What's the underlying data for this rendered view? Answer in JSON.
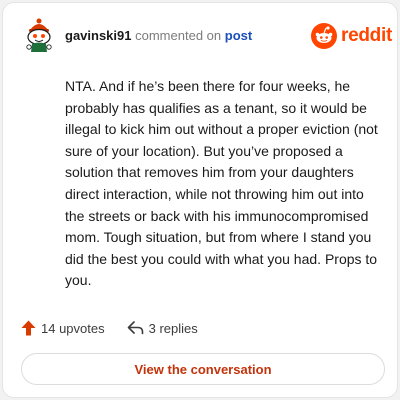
{
  "comment": {
    "username": "gavinski91",
    "action_text": "commented on",
    "post_link": "post",
    "body": "NTA. And if he’s been there for four weeks, he probably has qualifies as a tenant, so it would be illegal to kick him out without a proper eviction (not sure of your location). But you’ve proposed a solution that removes him from your daughters direct interaction, while not throwing him out into the streets or back with his immunocompromised mom. Tough situation, but from where I stand you did the best you could with what you had. Props to you."
  },
  "brand": {
    "wordmark": "reddit",
    "color": "#ff4500"
  },
  "actions": {
    "upvotes_label": "14 upvotes",
    "replies_label": "3 replies"
  },
  "cta": {
    "label": "View the conversation"
  },
  "icons": {
    "avatar": "snoo-avatar-icon",
    "logo": "reddit-snoo-icon",
    "upvote": "upvote-arrow-icon",
    "reply": "reply-arrow-icon"
  }
}
